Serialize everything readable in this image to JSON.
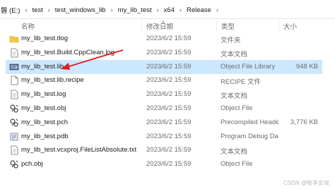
{
  "breadcrumb": [
    "磐 (E:)",
    "test",
    "test_windows_lib",
    "my_lib_test",
    "x64",
    "Release"
  ],
  "columns": {
    "name": "名称",
    "date": "修改日期",
    "type": "类型",
    "size": "大小"
  },
  "files": [
    {
      "name": "my_lib_test.tlog",
      "date": "2023/6/2 15:59",
      "type": "文件夹",
      "size": "",
      "icon": "folder-icon"
    },
    {
      "name": "my_lib_test.Build.CppClean.log",
      "date": "2023/6/2 15:59",
      "type": "文本文档",
      "size": "",
      "icon": "text-file-icon"
    },
    {
      "name": "my_lib_test.lib",
      "date": "2023/6/2 15:59",
      "type": "Object File Library",
      "size": "948 KB",
      "icon": "lib-file-icon"
    },
    {
      "name": "my_lib_test.lib.recipe",
      "date": "2023/6/2 15:59",
      "type": "RECIPE 文件",
      "size": "",
      "icon": "file-icon"
    },
    {
      "name": "my_lib_test.log",
      "date": "2023/6/2 15:59",
      "type": "文本文档",
      "size": "",
      "icon": "text-file-icon"
    },
    {
      "name": "my_lib_test.obj",
      "date": "2023/6/2 15:59",
      "type": "Object File",
      "size": "",
      "icon": "obj-file-icon"
    },
    {
      "name": "my_lib_test.pch",
      "date": "2023/6/2 15:59",
      "type": "Precompiled Heade...",
      "size": "3,776 KB",
      "icon": "obj-file-icon"
    },
    {
      "name": "my_lib_test.pdb",
      "date": "2023/6/2 15:59",
      "type": "Program Debug Da...",
      "size": "",
      "icon": "pdb-file-icon"
    },
    {
      "name": "my_lib_test.vcxproj.FileListAbsolute.txt",
      "date": "2023/6/2 15:59",
      "type": "文本文档",
      "size": "",
      "icon": "text-file-icon"
    },
    {
      "name": "pch.obj",
      "date": "2023/6/2 15:59",
      "type": "Object File",
      "size": "",
      "icon": "obj-file-icon"
    }
  ],
  "selected_index": 2,
  "colors": {
    "selected_row": "#cce8ff",
    "arrow": "#e01b1b",
    "folder": "#f6c64a"
  },
  "watermark": "CSDN @牧羊女说"
}
